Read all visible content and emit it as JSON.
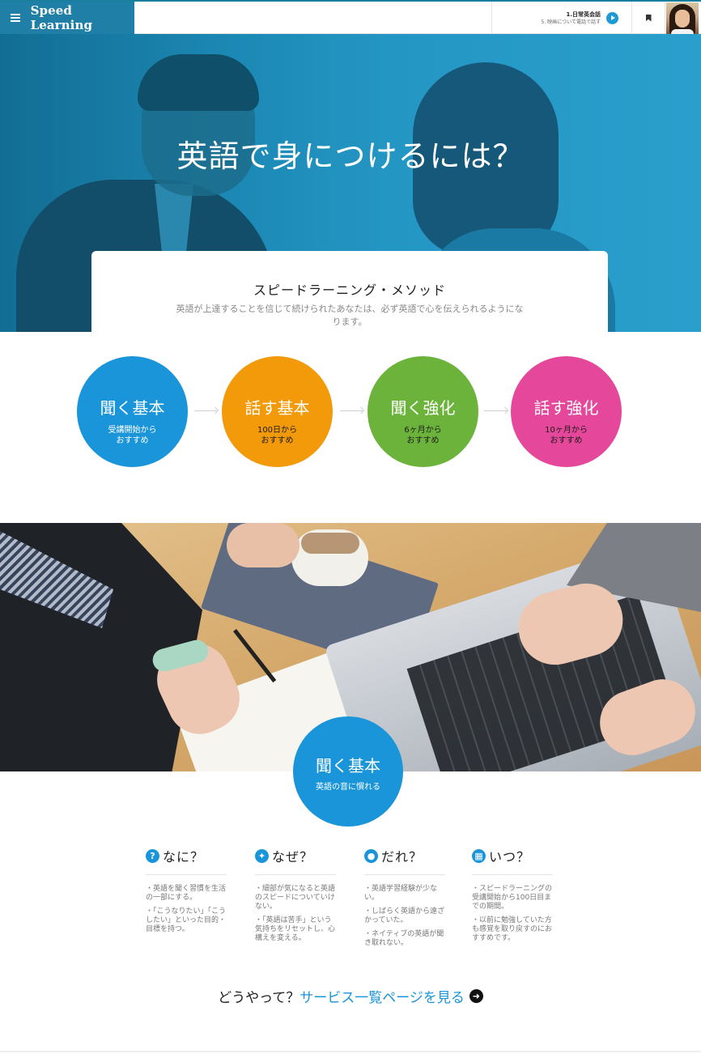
{
  "header": {
    "brand": "Speed Learning",
    "lesson_title": "1.日常英会話",
    "lesson_sub": "5. 映画について電話で話す"
  },
  "hero": {
    "title": "英語で身につけるには？",
    "card_title": "スピードラーニング・メソッド",
    "card_desc": "英語が上達することを信じて続けられたあなたは、必ず英語で心を伝えられるようになります。"
  },
  "steps": [
    {
      "title": "聞く基本",
      "sub_line1": "受講開始から",
      "sub_line2": "おすすめ",
      "color": "#1a95d9"
    },
    {
      "title": "話す基本",
      "sub_line1": "100日から",
      "sub_line2": "おすすめ",
      "color": "#f39a0b"
    },
    {
      "title": "聞く強化",
      "sub_line1": "6ヶ月から",
      "sub_line2": "おすすめ",
      "color": "#6bb33a"
    },
    {
      "title": "話す強化",
      "sub_line1": "10ヶ月から",
      "sub_line2": "おすすめ",
      "color": "#e5479a"
    }
  ],
  "feature": {
    "title": "聞く基本",
    "sub": "英語の音に慣れる"
  },
  "columns": [
    {
      "icon": "question-icon",
      "title": "なに？",
      "items": [
        "・英語を聞く習慣を生活の一部にする。",
        "・「こうなりたい」「こうしたい」といった目的・目標を持つ。"
      ]
    },
    {
      "icon": "lightbulb-icon",
      "title": "なぜ？",
      "items": [
        "・細部が気になると英語のスピードについていけない。",
        "・「英語は苦手」という気持ちをリセットし、心構えを変える。"
      ]
    },
    {
      "icon": "user-icon",
      "title": "だれ？",
      "items": [
        "・英語学習経験が少ない。",
        "・しばらく英語から遠ざかっていた。",
        "・ネイティブの英語が聞き取れない。"
      ]
    },
    {
      "icon": "calendar-icon",
      "title": "いつ？",
      "items": [
        "・スピードラーニングの受講開始から100日目までの期間。",
        "・以前に勉強していた方も感覚を取り戻すのにおすすめです。"
      ]
    }
  ],
  "cta": {
    "prefix": "どうやって？",
    "link": "サービス一覧ページを見る"
  },
  "colors": {
    "brand": "#1f7fa6",
    "accent_blue": "#1a95d9"
  }
}
